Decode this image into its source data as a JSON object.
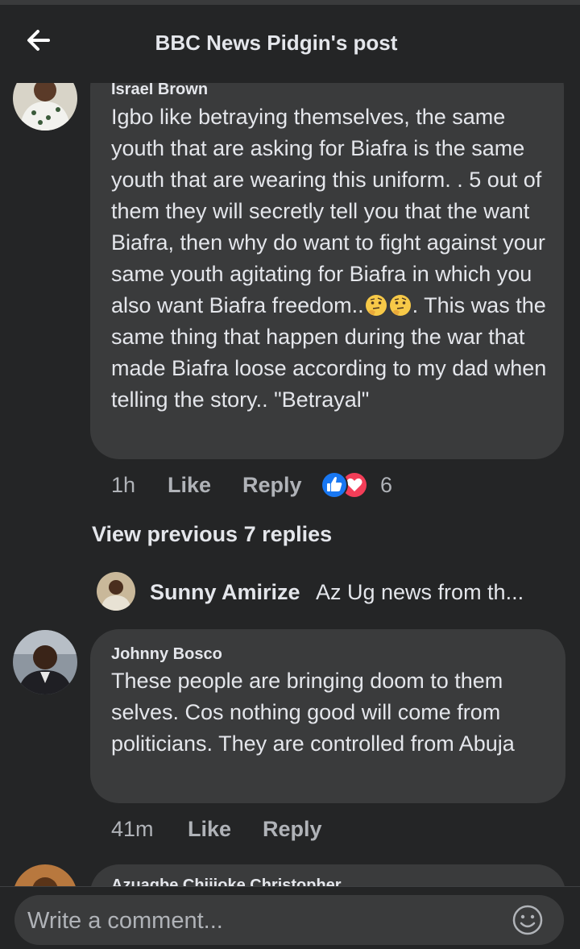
{
  "header": {
    "title": "BBC News Pidgin's post",
    "back_icon": "arrow-left-icon"
  },
  "comments": [
    {
      "author": "Israel Brown",
      "text_before_emoji": "Igbo like betraying themselves, the same youth that are asking for Biafra is the same youth that are wearing this uniform. . 5 out of them they will secretly tell you that the want Biafra, then why do want to fight against your same youth agitating for Biafra in which you also want Biafra freedom..",
      "emoji": "thinking-face-icon",
      "text_after_emoji": ". This was the same thing that happen during the war that made Biafra loose according to my dad when telling the story.. \"Betrayal\"",
      "time": "1h",
      "like_label": "Like",
      "reply_label": "Reply",
      "reactions": [
        "like-reaction-icon",
        "love-reaction-icon"
      ],
      "reaction_count": "6"
    },
    {
      "author": "Johnny Bosco",
      "text": "These people are  bringing  doom to them selves. Cos nothing  good will  come from politicians. They are  controlled from Abuja",
      "time": "41m",
      "like_label": "Like",
      "reply_label": "Reply"
    },
    {
      "author": "Azuagbe Chijioke Christopher"
    }
  ],
  "view_previous": "View previous 7 replies",
  "reply_preview": {
    "name": "Sunny Amirize",
    "snippet": "Az Ug news from th..."
  },
  "composer": {
    "placeholder": "Write a comment...",
    "emoji_icon": "smiley-face-icon"
  },
  "colors": {
    "background": "#242526",
    "bubble": "#3a3b3c",
    "text": "#e4e6eb",
    "secondary": "#b0b3b8",
    "like_blue": "#1877f2",
    "love_red": "#f33e58"
  }
}
